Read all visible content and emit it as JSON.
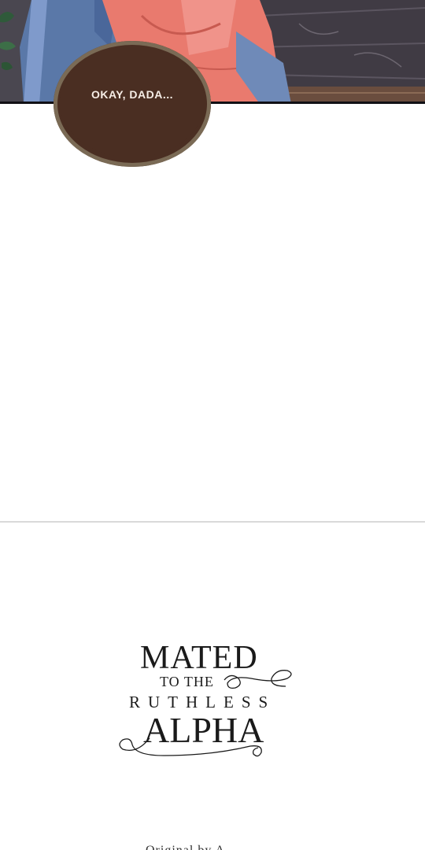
{
  "panel": {
    "speech_bubble": "OKAY, DADA..."
  },
  "title_logo": {
    "line1": "MATED",
    "line2": "TO THE",
    "line3": "RUTHLESS",
    "line4": "ALPHA"
  },
  "footer": {
    "partial_credit": "Original by A"
  }
}
